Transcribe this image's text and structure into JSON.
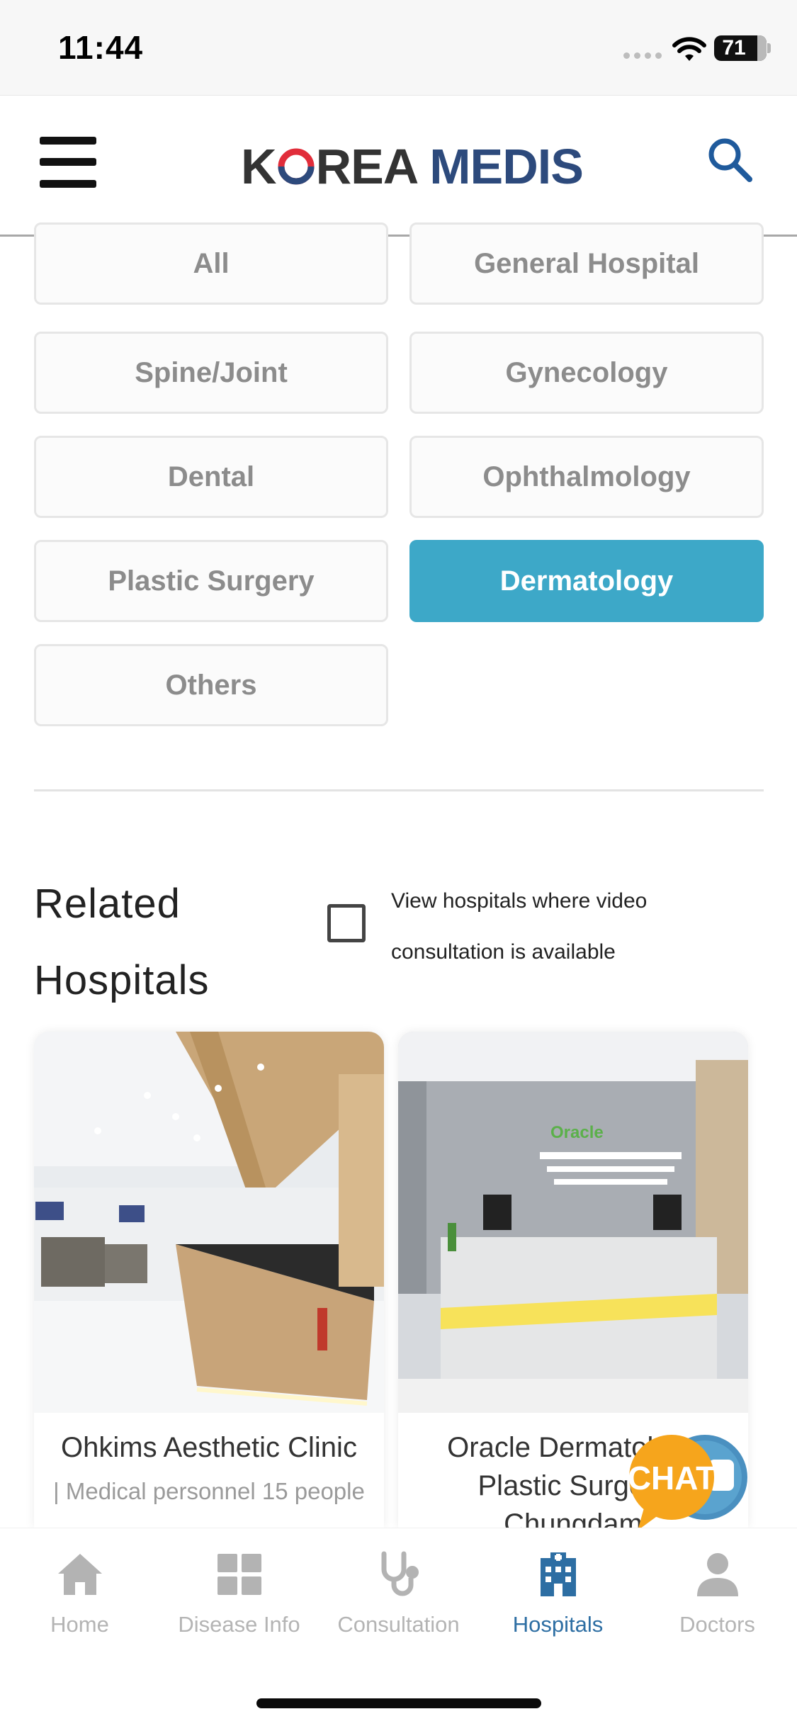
{
  "status_bar": {
    "time": "11:44",
    "battery": "71"
  },
  "header": {
    "logo_part1": "K",
    "logo_part2": "REA",
    "logo_part3": "MEDIS"
  },
  "categories": [
    {
      "label": "All",
      "active": false
    },
    {
      "label": "General Hospital",
      "active": false
    },
    {
      "label": "Spine/Joint",
      "active": false
    },
    {
      "label": "Gynecology",
      "active": false
    },
    {
      "label": "Dental",
      "active": false
    },
    {
      "label": "Ophthalmology",
      "active": false
    },
    {
      "label": "Plastic Surgery",
      "active": false
    },
    {
      "label": "Dermatology",
      "active": true
    },
    {
      "label": "Others",
      "active": false
    }
  ],
  "related": {
    "title": "Related Hospitals",
    "video_filter_label": "View hospitals where video consultation is available",
    "video_filter_checked": false
  },
  "hospitals": [
    {
      "name": "Ohkims Aesthetic Clinic",
      "meta": "| Medical personnel 15 people"
    },
    {
      "name": "Oracle Dermatology Plastic Surgery Chungdam",
      "meta": ""
    }
  ],
  "chat": {
    "label": "CHAT"
  },
  "bottom_nav": [
    {
      "label": "Home",
      "icon": "home-icon",
      "active": false
    },
    {
      "label": "Disease Info",
      "icon": "grid-icon",
      "active": false
    },
    {
      "label": "Consultation",
      "icon": "stethoscope-icon",
      "active": false
    },
    {
      "label": "Hospitals",
      "icon": "hospital-icon",
      "active": true
    },
    {
      "label": "Doctors",
      "icon": "person-icon",
      "active": false
    }
  ],
  "colors": {
    "accent": "#3da8c8",
    "brand_blue": "#2d4a7c",
    "nav_active": "#2d6ea3",
    "chat_orange": "#f6a51c"
  }
}
